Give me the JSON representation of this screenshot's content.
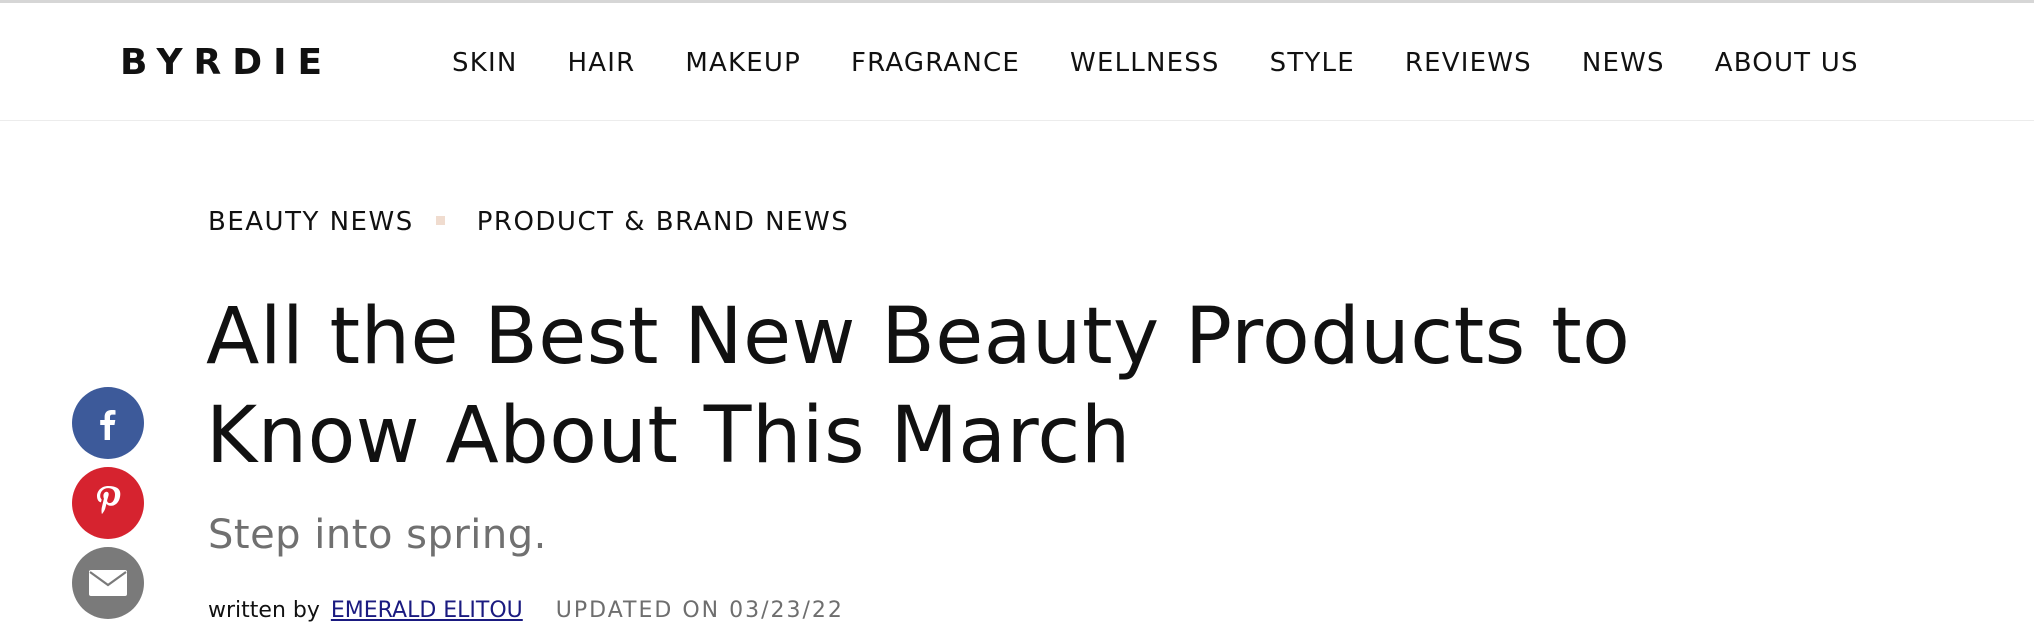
{
  "site": {
    "logo": "BYRDIE"
  },
  "nav": {
    "items": [
      {
        "label": "SKIN"
      },
      {
        "label": "HAIR"
      },
      {
        "label": "MAKEUP"
      },
      {
        "label": "FRAGRANCE"
      },
      {
        "label": "WELLNESS"
      },
      {
        "label": "STYLE"
      },
      {
        "label": "REVIEWS"
      },
      {
        "label": "NEWS"
      },
      {
        "label": "ABOUT US"
      }
    ]
  },
  "breadcrumb": {
    "items": [
      {
        "label": "BEAUTY NEWS"
      },
      {
        "label": "PRODUCT & BRAND NEWS"
      }
    ]
  },
  "article": {
    "title": "All the Best New Beauty Products to Know About This March",
    "subtitle": "Step into spring.",
    "byline_prefix": "written by",
    "author": "EMERALD ELITOU",
    "updated": "UPDATED ON 03/23/22"
  },
  "share": {
    "icons": [
      "facebook-icon",
      "pinterest-icon",
      "email-icon"
    ],
    "colors": {
      "facebook": "#3d5a9a",
      "pinterest": "#d6232f",
      "email": "#7a7a7a"
    }
  },
  "colors": {
    "text": "#111111",
    "subtitle": "#707070",
    "author_link": "#1a1a80",
    "crumb_separator": "#f0dccf"
  }
}
